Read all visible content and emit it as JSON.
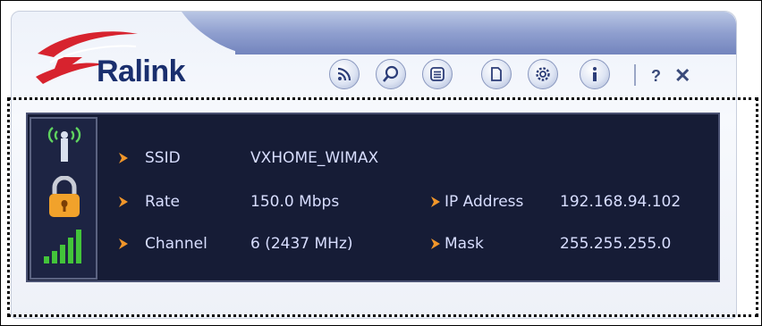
{
  "app": {
    "brand": "Ralink"
  },
  "toolbar": {
    "buttons": [
      {
        "icon": "wireless-icon"
      },
      {
        "icon": "search-icon"
      },
      {
        "icon": "list-icon"
      },
      {
        "icon": "document-icon"
      },
      {
        "icon": "gear-icon"
      },
      {
        "icon": "info-icon"
      }
    ],
    "help_label": "?",
    "close_label": "✕"
  },
  "connection": {
    "ssid_label": "SSID",
    "ssid_value": "VXHOME_WIMAX",
    "rate_label": "Rate",
    "rate_value": "150.0 Mbps",
    "channel_label": "Channel",
    "channel_value": "6 (2437 MHz)",
    "ip_label": "IP Address",
    "ip_value": "192.168.94.102",
    "mask_label": "Mask",
    "mask_value": "255.255.255.0"
  },
  "status": {
    "icons": [
      "antenna-icon",
      "lock-icon",
      "signal-strength-icon"
    ]
  },
  "colors": {
    "panel_bg": "#161c36",
    "accent_orange": "#f2962a",
    "text": "#d8deff",
    "title_bar": "#8f9fcf"
  }
}
